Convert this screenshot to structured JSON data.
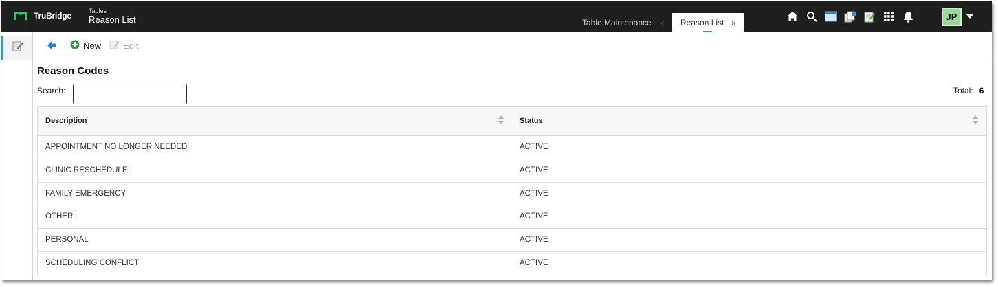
{
  "header": {
    "brand": "TruBridge",
    "module_small": "Tables",
    "module_title": "Reason List",
    "colors": {
      "bar": "#1f1f1f",
      "accent": "#3a8fd6",
      "avatar_bg": "#9bd79a"
    },
    "tabs": [
      {
        "label": "Table Maintenance",
        "active": false
      },
      {
        "label": "Reason List",
        "active": true
      }
    ],
    "close_glyph": "×",
    "icons": [
      "home-icon",
      "search-icon",
      "window-icon",
      "documents-icon",
      "notes-icon",
      "apps-grid-icon",
      "bell-icon"
    ],
    "user_initials": "JP"
  },
  "toolbar": {
    "new_label": "New",
    "edit_label": "Edit"
  },
  "page": {
    "heading": "Reason Codes",
    "search_label": "Search:",
    "search_value": "",
    "total_label": "Total:",
    "total_value": "6"
  },
  "table": {
    "columns": [
      "Description",
      "Status"
    ],
    "rows": [
      {
        "description": "APPOINTMENT NO LONGER NEEDED",
        "status": "ACTIVE"
      },
      {
        "description": "CLINIC RESCHEDULE",
        "status": "ACTIVE"
      },
      {
        "description": "FAMILY EMERGENCY",
        "status": "ACTIVE"
      },
      {
        "description": "OTHER",
        "status": "ACTIVE"
      },
      {
        "description": "PERSONAL",
        "status": "ACTIVE"
      },
      {
        "description": "SCHEDULING CONFLICT",
        "status": "ACTIVE"
      }
    ]
  }
}
